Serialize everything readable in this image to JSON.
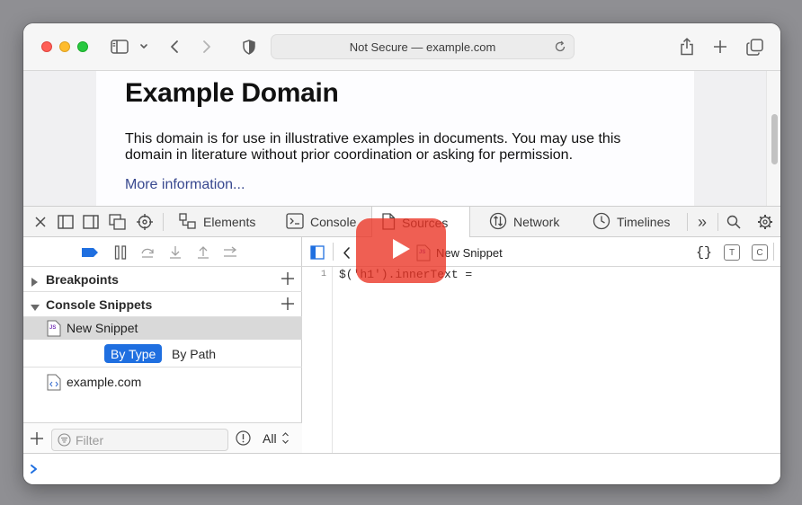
{
  "browser": {
    "address": "Not Secure — example.com"
  },
  "page": {
    "title": "Example Domain",
    "paragraph": "This domain is for use in illustrative examples in documents. You may use this domain in literature without prior coordination or asking for permission.",
    "link": "More information..."
  },
  "devtools": {
    "tabs": [
      {
        "label": "Elements",
        "icon": "elements-icon"
      },
      {
        "label": "Console",
        "icon": "console-icon"
      },
      {
        "label": "Sources",
        "icon": "sources-icon",
        "active": true
      },
      {
        "label": "Network",
        "icon": "network-icon"
      },
      {
        "label": "Timelines",
        "icon": "timelines-icon"
      }
    ],
    "more_label": "»"
  },
  "navigator": {
    "breakpoints_label": "Breakpoints",
    "snippets_label": "Console Snippets",
    "snippet_name": "New Snippet",
    "snippet_icon_text": "JS",
    "group_by": [
      "By Type",
      "By Path"
    ],
    "group_by_selected": "By Type",
    "resource": "example.com",
    "filter_placeholder": "Filter",
    "scope_label": "All"
  },
  "editor": {
    "file_name": "New Snippet",
    "line_number": "1",
    "code": "$('h1').innerText =",
    "format_label": "{}",
    "type_badge": "T",
    "coverage_badge": "C"
  },
  "colors": {
    "accent": "#1f6fe0",
    "overlay": "#eb3223",
    "link": "#38488f"
  }
}
